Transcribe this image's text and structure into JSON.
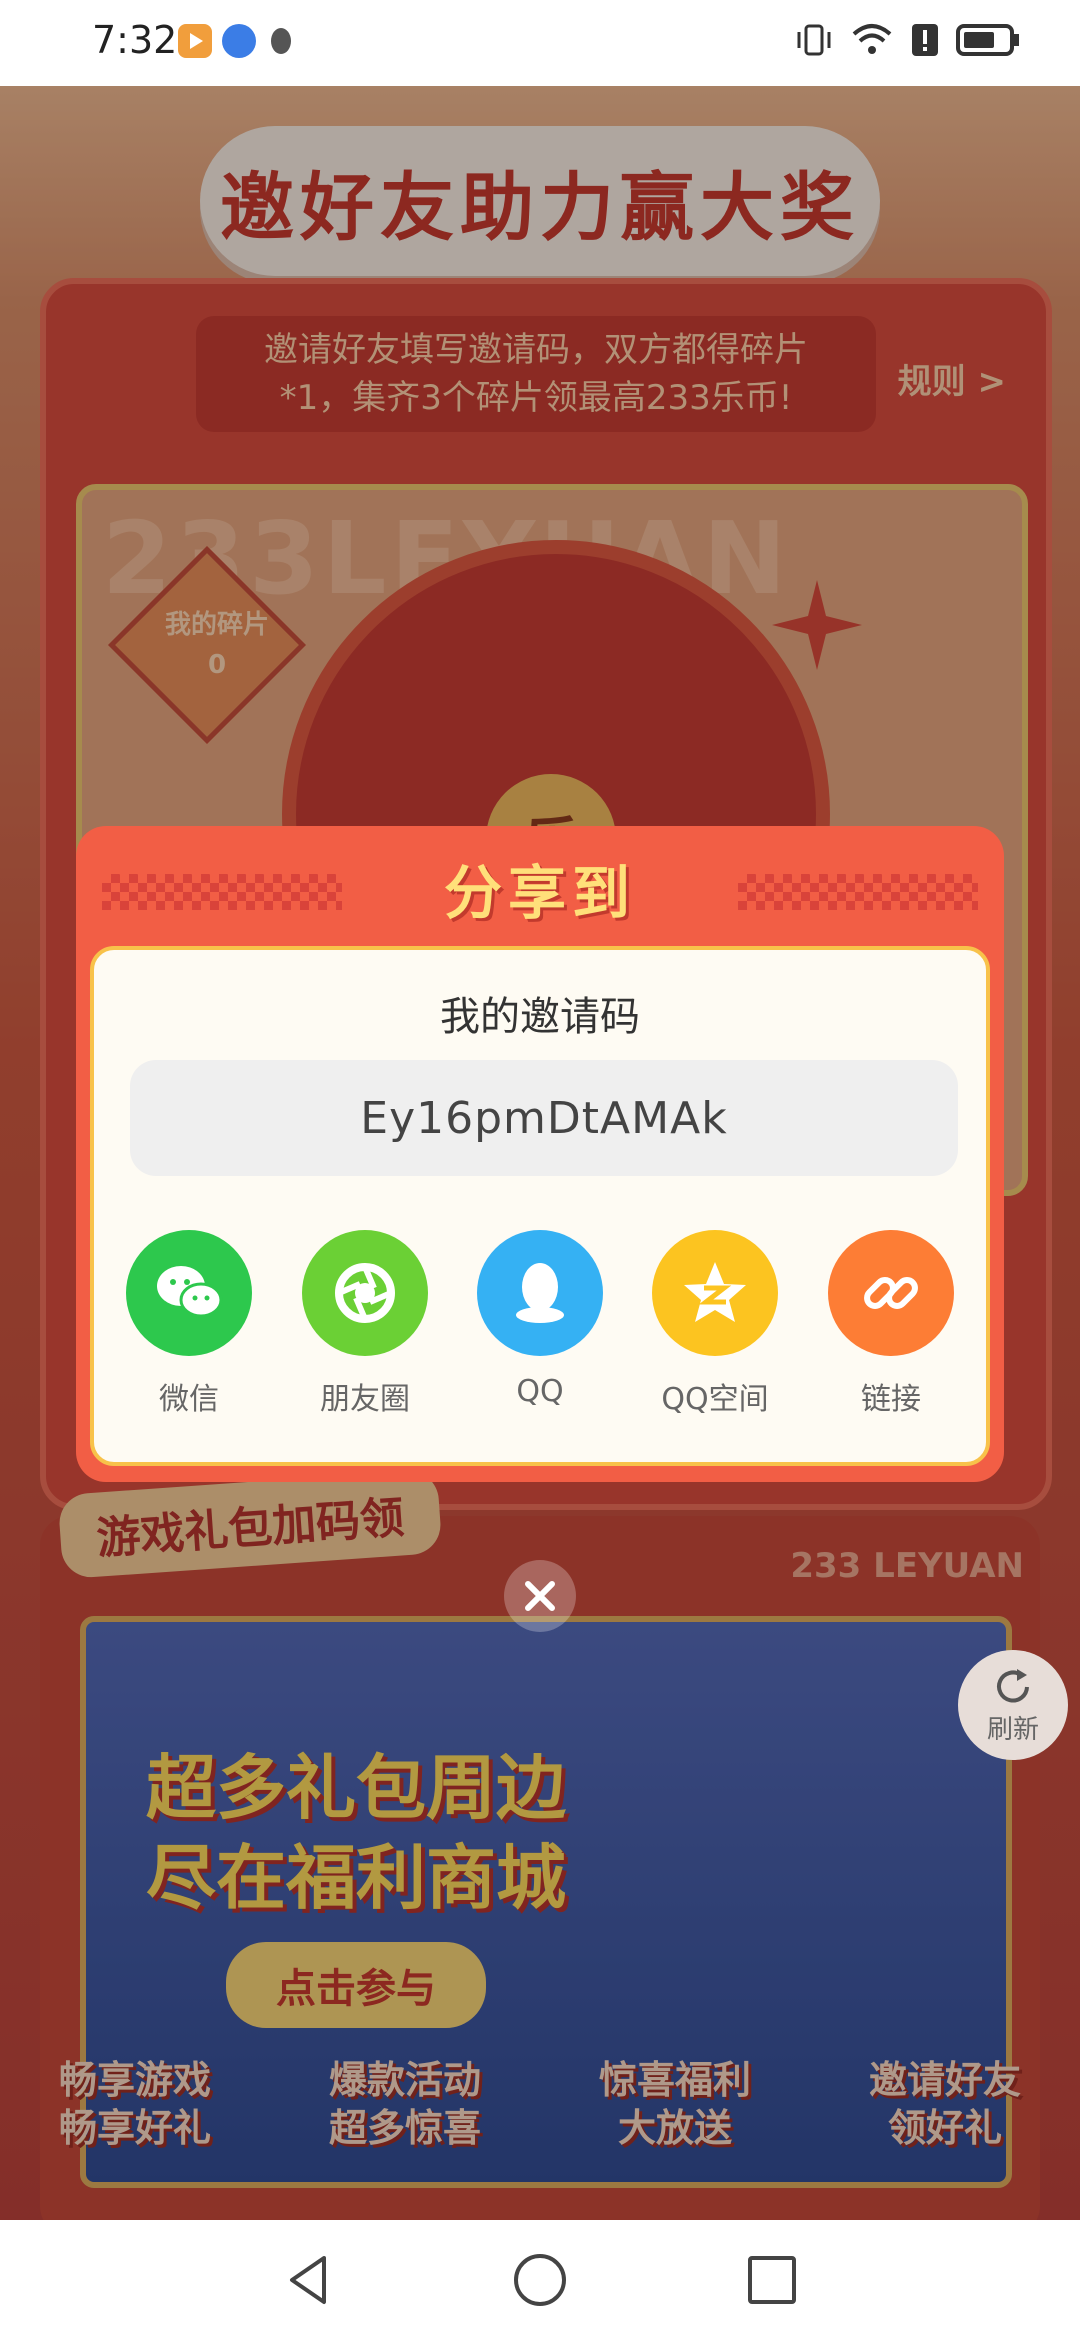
{
  "status_bar": {
    "time": "7:32",
    "icons": [
      "media-app-icon",
      "browser-icon",
      "qq-penguin-icon",
      "vibrate-icon",
      "wifi-icon",
      "alert-icon",
      "battery-icon"
    ]
  },
  "page": {
    "title": "邀好友助力赢大奖",
    "banner_line1": "邀请好友填写邀请码，双方都得碎片",
    "banner_line2": "*1，集齐3个碎片领最高233乐币!",
    "rules": "规则 >",
    "watermark": "233LEYUAN",
    "fragment_label": "我的碎片",
    "fragment_count": "0",
    "wheel_center": "乐",
    "gift_tag": "游戏礼包加码领",
    "leyuan_text": "233 LEYUAN",
    "promo_line1": "超多礼包周边",
    "promo_line2": "尽在福利商城",
    "promo_button": "点击参与",
    "refresh_label": "刷新",
    "features": [
      {
        "line1": "畅享游戏",
        "line2": "畅享好礼"
      },
      {
        "line1": "爆款活动",
        "line2": "超多惊喜"
      },
      {
        "line1": "惊喜福利",
        "line2": "大放送"
      },
      {
        "line1": "邀请好友",
        "line2": "领好礼"
      }
    ]
  },
  "modal": {
    "title": "分享到",
    "code_label": "我的邀请码",
    "code": "Ey16pmDtAMAk",
    "share_targets": [
      {
        "label": "微信",
        "icon": "wechat-icon",
        "color": "#2dc84d"
      },
      {
        "label": "朋友圈",
        "icon": "moments-icon",
        "color": "#6bd035"
      },
      {
        "label": "QQ",
        "icon": "qq-icon",
        "color": "#35b1f3"
      },
      {
        "label": "QQ空间",
        "icon": "qzone-icon",
        "color": "#fcc420"
      },
      {
        "label": "链接",
        "icon": "link-icon",
        "color": "#fd7d35"
      }
    ]
  },
  "navbar": {
    "buttons": [
      "back-icon",
      "home-icon",
      "recents-icon"
    ]
  }
}
